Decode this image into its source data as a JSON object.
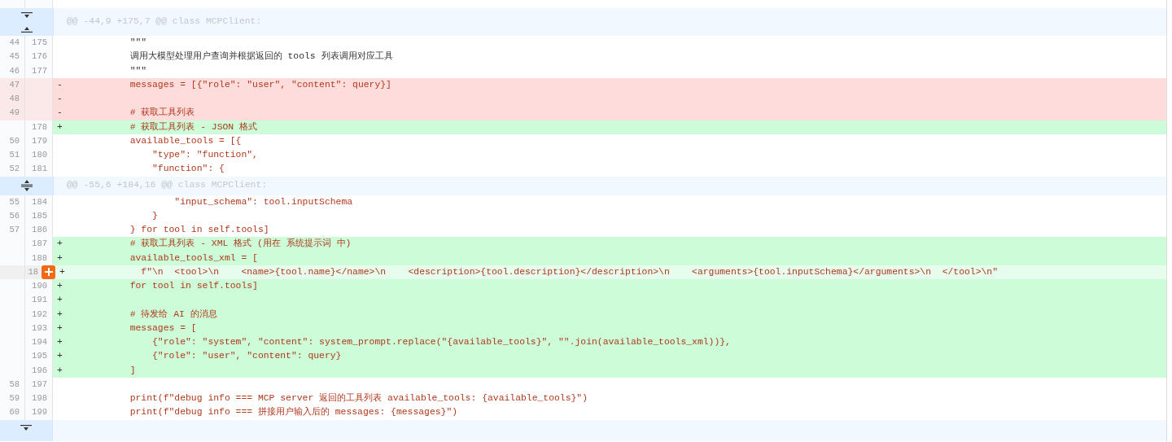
{
  "lines": [
    {
      "kind": "hunk_split",
      "code": "@@ -44,9 +175,7 @@ class MCPClient:"
    },
    {
      "kind": "context",
      "old": "44",
      "new": "175",
      "code": "        \"\"\"",
      "docstring": true,
      "hovered": false
    },
    {
      "kind": "context",
      "old": "45",
      "new": "176",
      "code": "        调用大模型处理用户查询并根据返回的 tools 列表调用对应工具",
      "docstring": true,
      "hovered": false
    },
    {
      "kind": "context",
      "old": "46",
      "new": "177",
      "code": "        \"\"\"",
      "docstring": true,
      "hovered": false
    },
    {
      "kind": "removed",
      "old": "47",
      "sign": "-",
      "code": "        messages = [{\"role\": \"user\", \"content\": query}]",
      "docstring": false,
      "hovered": false
    },
    {
      "kind": "removed",
      "old": "48",
      "sign": "-",
      "hovered": false
    },
    {
      "kind": "removed",
      "old": "49",
      "sign": "-",
      "code": "        # 获取工具列表",
      "docstring": false,
      "hovered": false
    },
    {
      "kind": "added",
      "new": "178",
      "sign": "+",
      "code": "        # 获取工具列表 - JSON 格式",
      "docstring": false,
      "hovered": false
    },
    {
      "kind": "context",
      "old": "50",
      "new": "179",
      "code": "        available_tools = [{",
      "docstring": false,
      "hovered": false
    },
    {
      "kind": "context",
      "old": "51",
      "new": "180",
      "code": "            \"type\": \"function\",",
      "docstring": false,
      "hovered": false
    },
    {
      "kind": "context",
      "old": "52",
      "new": "181",
      "code": "            \"function\": {",
      "docstring": false,
      "hovered": false
    },
    {
      "kind": "hunk_both",
      "code": "@@ -55,6 +184,16 @@ class MCPClient:"
    },
    {
      "kind": "context",
      "old": "55",
      "new": "184",
      "code": "                \"input_schema\": tool.inputSchema",
      "docstring": false,
      "hovered": false
    },
    {
      "kind": "context",
      "old": "56",
      "new": "185",
      "code": "            }",
      "docstring": false,
      "hovered": false
    },
    {
      "kind": "context",
      "old": "57",
      "new": "186",
      "code": "        } for tool in self.tools]",
      "docstring": false,
      "hovered": false
    },
    {
      "kind": "added",
      "new": "187",
      "sign": "+",
      "code": "        # 获取工具列表 - XML 格式 (用在 系统提示词 中)",
      "docstring": false,
      "hovered": false
    },
    {
      "kind": "added",
      "new": "188",
      "sign": "+",
      "code": "        available_tools_xml = [",
      "docstring": false,
      "hovered": false
    },
    {
      "kind": "added",
      "new": "18",
      "sign": "+",
      "code": "          f\"\\n  <tool>\\n    <name>{tool.name}</name>\\n    <description>{tool.description}</description>\\n    <arguments>{tool.inputSchema}</arguments>\\n  </tool>\\n\"",
      "docstring": false,
      "hovered": true
    },
    {
      "kind": "added",
      "new": "190",
      "sign": "+",
      "code": "        for tool in self.tools]",
      "docstring": false,
      "hovered": false
    },
    {
      "kind": "added",
      "new": "191",
      "sign": "+",
      "hovered": false
    },
    {
      "kind": "added",
      "new": "192",
      "sign": "+",
      "code": "        # 待发给 AI 的消息",
      "docstring": false,
      "hovered": false
    },
    {
      "kind": "added",
      "new": "193",
      "sign": "+",
      "code": "        messages = [",
      "docstring": false,
      "hovered": false
    },
    {
      "kind": "added",
      "new": "194",
      "sign": "+",
      "code": "            {\"role\": \"system\", \"content\": system_prompt.replace(\"{available_tools}\", \"\".join(available_tools_xml))},",
      "docstring": false,
      "hovered": false
    },
    {
      "kind": "added",
      "new": "195",
      "sign": "+",
      "code": "            {\"role\": \"user\", \"content\": query}",
      "docstring": false,
      "hovered": false
    },
    {
      "kind": "added",
      "new": "196",
      "sign": "+",
      "code": "        ]",
      "docstring": false,
      "hovered": false
    },
    {
      "kind": "context",
      "old": "58",
      "new": "197",
      "hovered": false
    },
    {
      "kind": "context",
      "old": "59",
      "new": "198",
      "code": "        print(f\"debug info === MCP server 返回的工具列表 available_tools: {available_tools}\")",
      "docstring": false,
      "hovered": false
    },
    {
      "kind": "context",
      "old": "60",
      "new": "199",
      "code": "        print(f\"debug info === 拼接用户输入后的 messages: {messages}\")",
      "docstring": false,
      "hovered": false
    },
    {
      "kind": "hunk_down"
    }
  ]
}
